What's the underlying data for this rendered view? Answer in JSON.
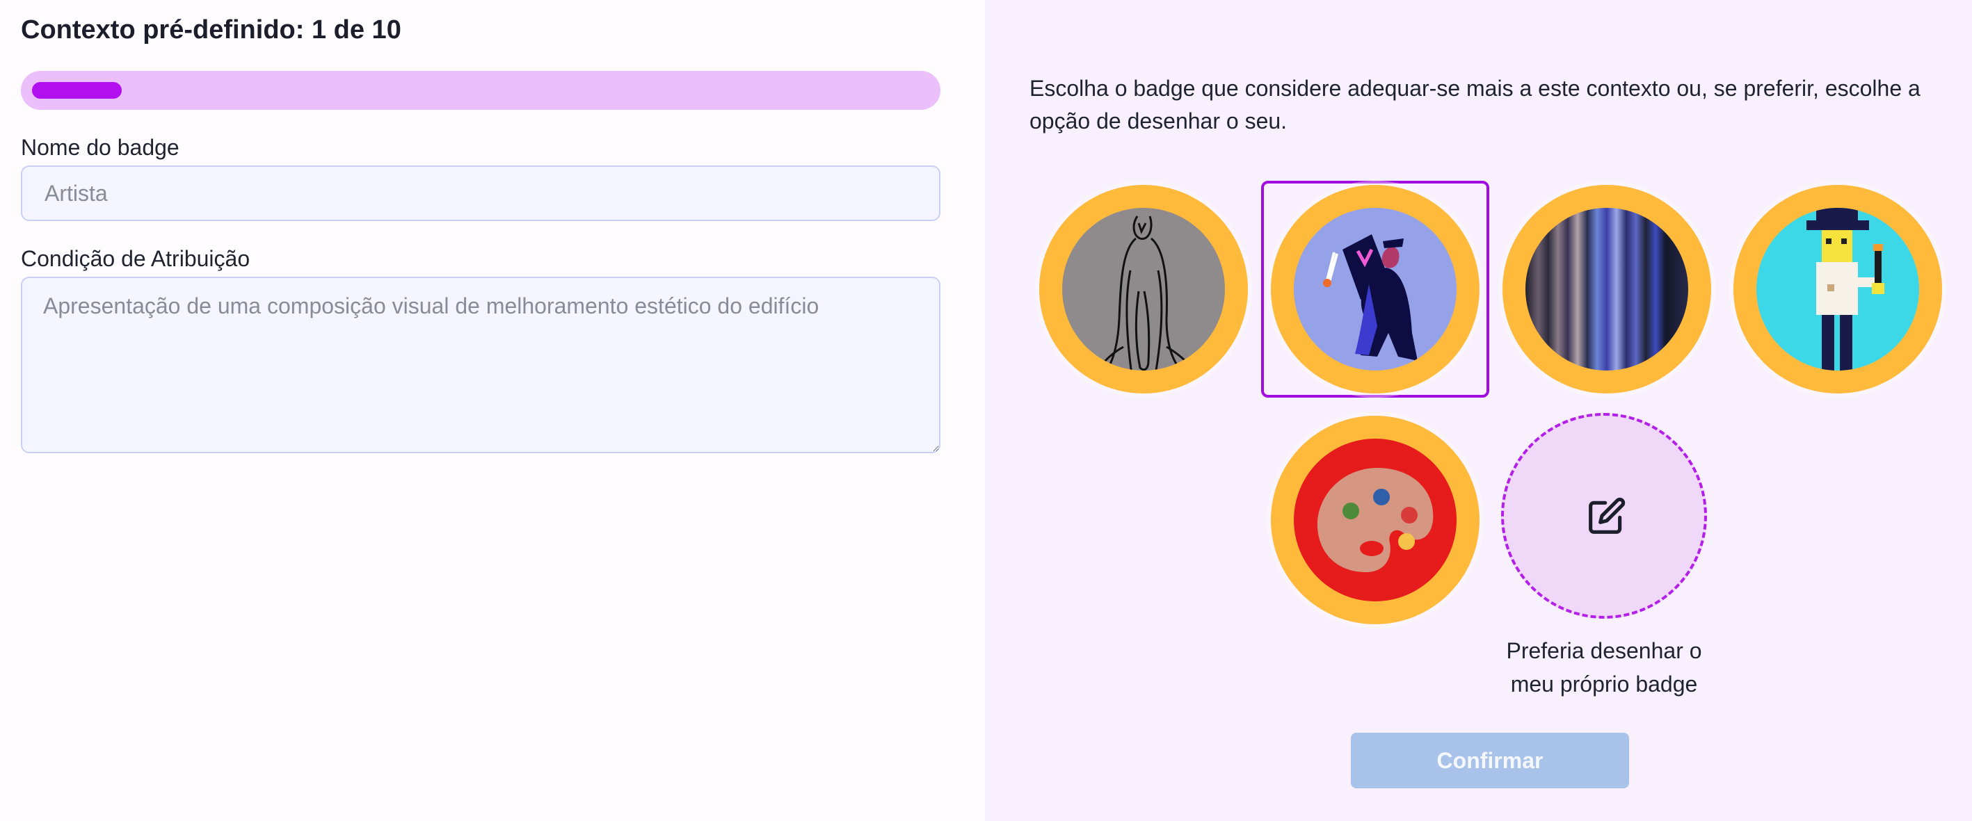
{
  "header": {
    "title": "Contexto pré-definido: 1 de 10"
  },
  "progress": {
    "fraction": 0.1
  },
  "form": {
    "name_label": "Nome do badge",
    "name_placeholder": "Artista",
    "condition_label": "Condição de Atribuição",
    "condition_placeholder": "Apresentação de uma composição visual de melhoramento estético do edifício"
  },
  "selector": {
    "instructions": "Escolha o badge que considere adequar-se mais a este contexto ou, se preferir, escolhe a opção de desenhar o seu.",
    "badges": [
      {
        "icon": "sketch-figure-icon",
        "selected": false
      },
      {
        "icon": "painter-with-canvas-icon",
        "selected": true
      },
      {
        "icon": "abstract-stripes-icon",
        "selected": false
      },
      {
        "icon": "pixel-artist-icon",
        "selected": false
      },
      {
        "icon": "paint-palette-icon",
        "selected": false
      }
    ],
    "draw_own": {
      "icon": "edit-icon",
      "label_line1": "Preferia desenhar o",
      "label_line2": "meu próprio badge"
    },
    "confirm_label": "Confirmar"
  },
  "colors": {
    "badge_ring": "#ffba3b",
    "progress_track": "#eabffa",
    "progress_fill": "#b10ff0",
    "selection_border": "#a10de0",
    "confirm_disabled": "#a9c2ea",
    "right_panel_bg": "#f8f0fc"
  }
}
